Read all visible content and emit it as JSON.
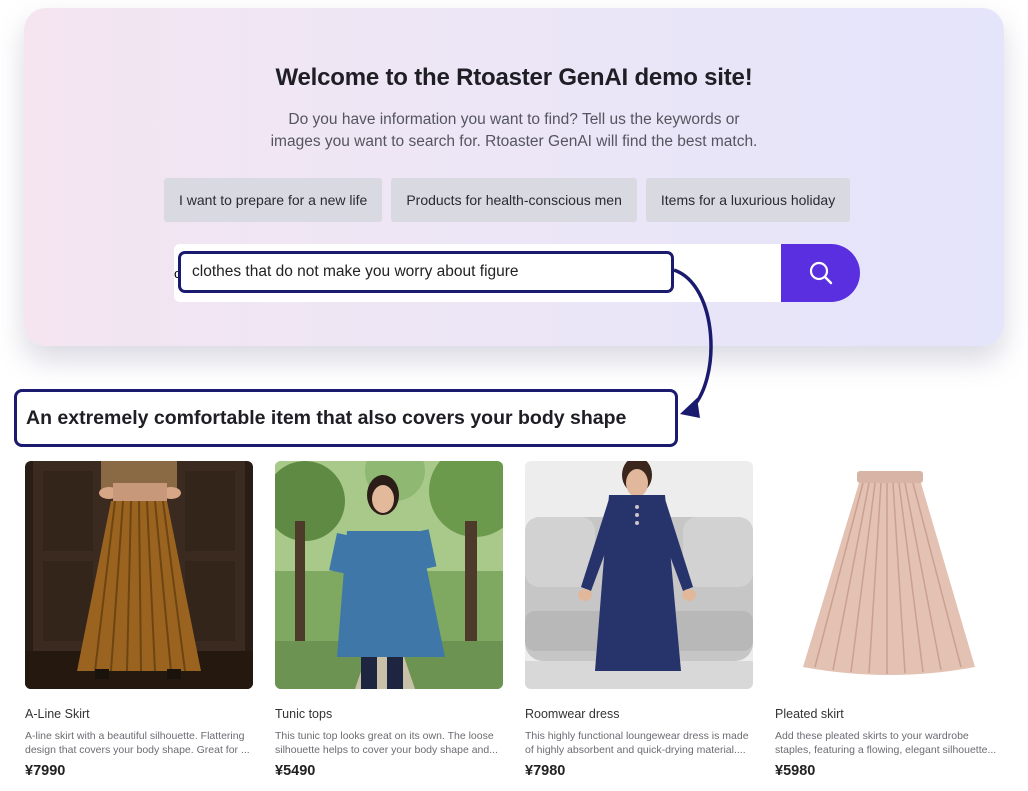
{
  "hero": {
    "title": "Welcome to the Rtoaster GenAI demo site!",
    "desc_line1": "Do you have information you want to find? Tell us the keywords or",
    "desc_line2": "images you want to search for. Rtoaster GenAI will find the best match."
  },
  "suggestions": [
    {
      "label": "I want to prepare for a new life"
    },
    {
      "label": "Products for health-conscious men"
    },
    {
      "label": "Items for a luxurious holiday"
    }
  ],
  "search": {
    "query": "clothes that do not make you worry about figure",
    "button_icon": "search-icon",
    "button_color": "#5a2fe0"
  },
  "annotation": {
    "answer": "An extremely comfortable item that also covers your body shape",
    "border_color": "#1a1a6e"
  },
  "products": [
    {
      "name": "A-Line Skirt",
      "desc": "A-line skirt with a beautiful silhouette. Flattering design that covers your body shape. Great for ...",
      "price": "¥7990"
    },
    {
      "name": "Tunic tops",
      "desc": "This tunic top looks great on its own. The loose silhouette helps to cover your body shape and...",
      "price": "¥5490"
    },
    {
      "name": "Roomwear dress",
      "desc": "This highly functional loungewear dress is made of highly absorbent and quick-drying material....",
      "price": "¥7980"
    },
    {
      "name": "Pleated skirt",
      "desc": "Add these pleated skirts to your wardrobe staples, featuring a flowing, elegant silhouette...",
      "price": "¥5980"
    }
  ]
}
